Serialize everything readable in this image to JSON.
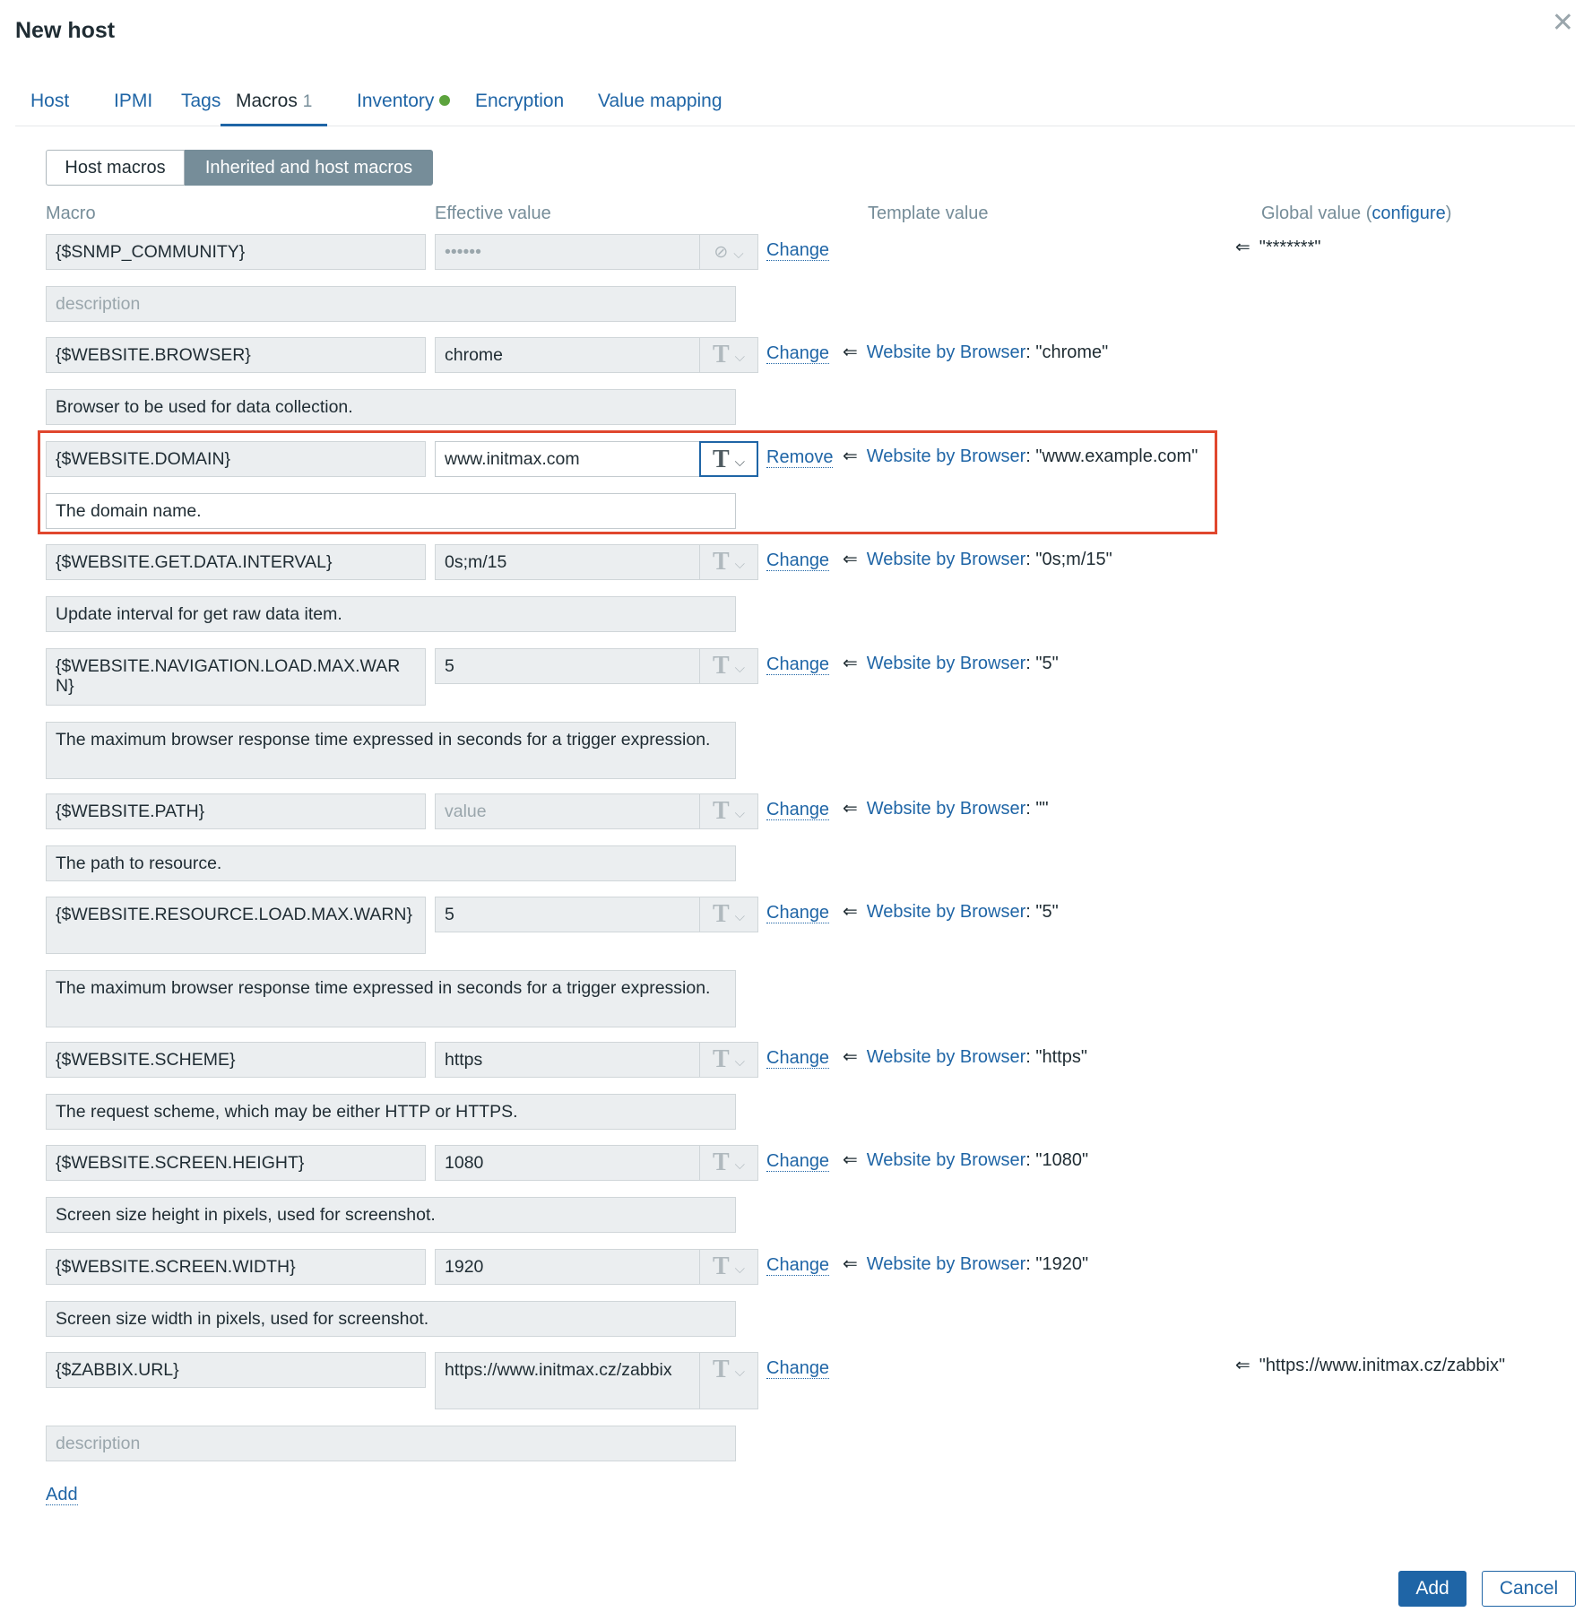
{
  "dialog": {
    "title": "New host",
    "close_icon": "close-icon"
  },
  "tabs": [
    {
      "label": "Host"
    },
    {
      "label": "IPMI"
    },
    {
      "label": "Tags"
    },
    {
      "label": "Macros",
      "count": "1"
    },
    {
      "label": "Inventory",
      "indicator_color": "#5ca33d"
    },
    {
      "label": "Encryption"
    },
    {
      "label": "Value mapping"
    }
  ],
  "segmented": {
    "host_macros": "Host macros",
    "inherited": "Inherited and host macros"
  },
  "headers": {
    "macro": "Macro",
    "effective_value": "Effective value",
    "template_value": "Template value",
    "global_value": "Global value",
    "global_open": "(",
    "configure": "configure",
    "global_close": ")"
  },
  "arrow": "⇐",
  "template_sep": ": ",
  "value_placeholder": "value",
  "description_placeholder": "description",
  "macros": [
    {
      "macro": "{$SNMP_COMMUNITY}",
      "value": "••••••",
      "value_type": "secret",
      "action": "Change",
      "description": "",
      "template_name": "",
      "template_value": "",
      "global_value": "\"*******\""
    },
    {
      "macro": "{$WEBSITE.BROWSER}",
      "value": "chrome",
      "value_type": "text",
      "action": "Change",
      "description": "Browser to be used for data collection.",
      "template_name": "Website by Browser",
      "template_value": "\"chrome\"",
      "global_value": ""
    },
    {
      "macro": "{$WEBSITE.DOMAIN}",
      "value": "www.initmax.com",
      "value_type": "text",
      "action": "Remove",
      "description": "The domain name.",
      "template_name": "Website by Browser",
      "template_value": "\"www.example.com\"",
      "global_value": ""
    },
    {
      "macro": "{$WEBSITE.GET.DATA.INTERVAL}",
      "value": "0s;m/15",
      "value_type": "text",
      "action": "Change",
      "description": "Update interval for get raw data item.",
      "template_name": "Website by Browser",
      "template_value": "\"0s;m/15\"",
      "global_value": ""
    },
    {
      "macro": "{$WEBSITE.NAVIGATION.LOAD.MAX.WARN}",
      "value": "5",
      "value_type": "text",
      "action": "Change",
      "description": "The maximum browser response time expressed in seconds for a trigger expression.",
      "template_name": "Website by Browser",
      "template_value": "\"5\"",
      "global_value": ""
    },
    {
      "macro": "{$WEBSITE.PATH}",
      "value": "",
      "value_type": "text",
      "action": "Change",
      "description": "The path to resource.",
      "template_name": "Website by Browser",
      "template_value": "\"\"",
      "global_value": ""
    },
    {
      "macro": "{$WEBSITE.RESOURCE.LOAD.MAX.WARN}",
      "value": "5",
      "value_type": "text",
      "action": "Change",
      "description": "The maximum browser response time expressed in seconds for a trigger expression.",
      "template_name": "Website by Browser",
      "template_value": "\"5\"",
      "global_value": ""
    },
    {
      "macro": "{$WEBSITE.SCHEME}",
      "value": "https",
      "value_type": "text",
      "action": "Change",
      "description": "The request scheme, which may be either HTTP or HTTPS.",
      "template_name": "Website by Browser",
      "template_value": "\"https\"",
      "global_value": ""
    },
    {
      "macro": "{$WEBSITE.SCREEN.HEIGHT}",
      "value": "1080",
      "value_type": "text",
      "action": "Change",
      "description": "Screen size height in pixels, used for screenshot.",
      "template_name": "Website by Browser",
      "template_value": "\"1080\"",
      "global_value": ""
    },
    {
      "macro": "{$WEBSITE.SCREEN.WIDTH}",
      "value": "1920",
      "value_type": "text",
      "action": "Change",
      "description": "Screen size width in pixels, used for screenshot.",
      "template_name": "Website by Browser",
      "template_value": "\"1920\"",
      "global_value": ""
    },
    {
      "macro": "{$ZABBIX.URL}",
      "value": "https://www.initmax.cz/zabbix",
      "value_type": "text",
      "action": "Change",
      "description": "",
      "template_name": "",
      "template_value": "",
      "global_value": "\"https://www.initmax.cz/zabbix\""
    }
  ],
  "add_link": "Add",
  "footer": {
    "add": "Add",
    "cancel": "Cancel"
  },
  "colors": {
    "accent": "#1f65a6",
    "highlight": "#e0472e",
    "inactive_segment": "#768d99"
  }
}
